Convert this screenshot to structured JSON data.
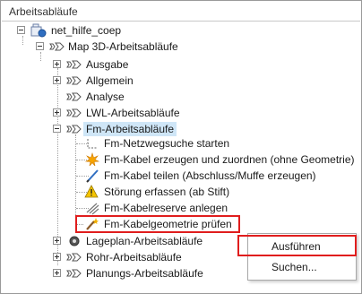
{
  "panel": {
    "title": "Arbeitsabläufe"
  },
  "tree": {
    "root": "net_hilfe_coep",
    "map": "Map 3D-Arbeitsabläufe",
    "groups": [
      "Ausgabe",
      "Allgemein",
      "Analyse",
      "LWL-Arbeitsabläufe",
      "Fm-Arbeitsabläufe"
    ],
    "fm_items": [
      {
        "label": "Fm-Netzwegsuche starten",
        "icon": "route-icon"
      },
      {
        "label": "Fm-Kabel erzeugen und zuordnen (ohne Geometrie)",
        "icon": "spark-icon"
      },
      {
        "label": "Fm-Kabel teilen (Abschluss/Muffe erzeugen)",
        "icon": "pen-icon"
      },
      {
        "label": "Störung erfassen (ab Stift)",
        "icon": "warning-icon"
      },
      {
        "label": "Fm-Kabelreserve anlegen",
        "icon": "reserve-icon"
      },
      {
        "label": "Fm-Kabelgeometrie prüfen",
        "icon": "wand-icon"
      }
    ],
    "after_groups": [
      "Lageplan-Arbeitsabläufe",
      "Rohr-Arbeitsabläufe",
      "Planungs-Arbeitsabläufe"
    ]
  },
  "context_menu": {
    "items": [
      "Ausführen",
      "Suchen..."
    ]
  },
  "colors": {
    "highlight": "#e01d1d",
    "selection": "#cfe6f7"
  }
}
